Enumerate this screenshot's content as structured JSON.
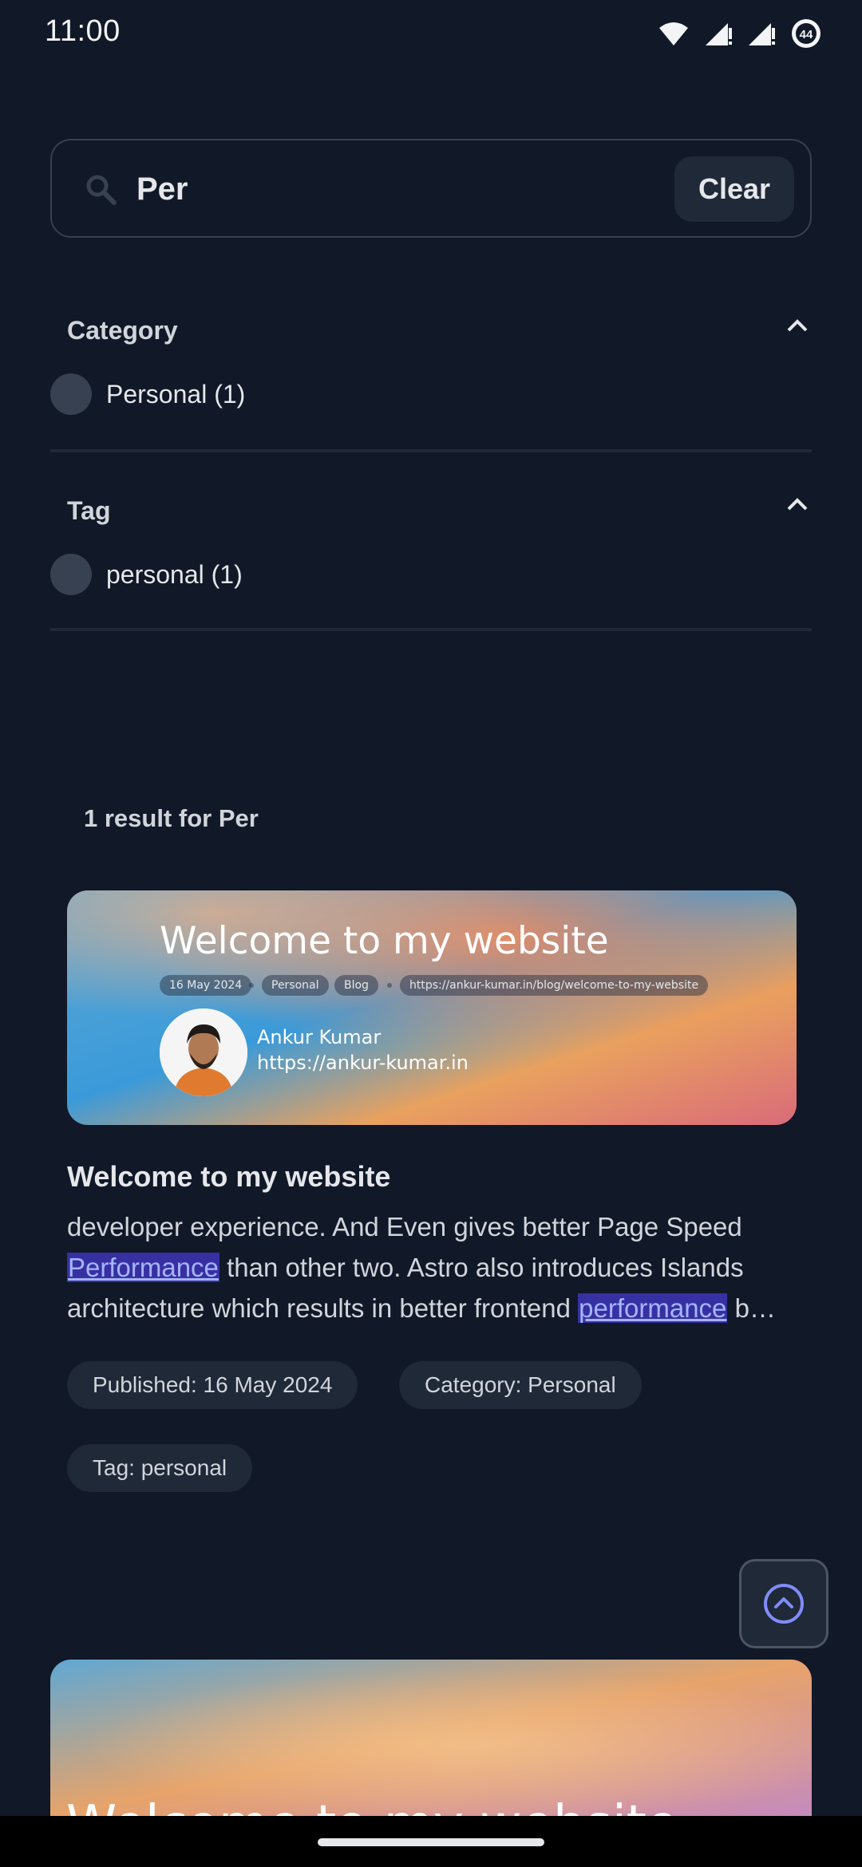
{
  "status_bar": {
    "time": "11:00",
    "battery": "44"
  },
  "search": {
    "value": "Per",
    "clear_label": "Clear"
  },
  "filters": [
    {
      "title": "Category",
      "options": [
        {
          "label": "Personal (1)"
        }
      ]
    },
    {
      "title": "Tag",
      "options": [
        {
          "label": "personal (1)"
        }
      ]
    }
  ],
  "results": {
    "count_text": "1 result for Per",
    "items": [
      {
        "image": {
          "title": "Welcome to my website",
          "date": "16 May 2024",
          "category": "Personal",
          "type": "Blog",
          "url": "https://ankur-kumar.in/blog/welcome-to-my-website",
          "author_name": "Ankur Kumar",
          "author_site": "https://ankur-kumar.in"
        },
        "title": "Welcome to my website",
        "excerpt": {
          "part1": "developer experience. And Even gives better Page Speed ",
          "highlight1": "Performance",
          "part2": " than other two. Astro also introduces Islands architecture which results in better frontend ",
          "highlight2": "performance",
          "part3": " b…"
        },
        "meta": {
          "published": "Published: 16 May 2024",
          "category": "Category: Personal",
          "tag": "Tag: personal"
        }
      }
    ]
  },
  "next_card": {
    "title": "Welcome to my website"
  },
  "colors": {
    "background": "#111827",
    "accent": "#818cf8",
    "surface": "#1f2937"
  }
}
